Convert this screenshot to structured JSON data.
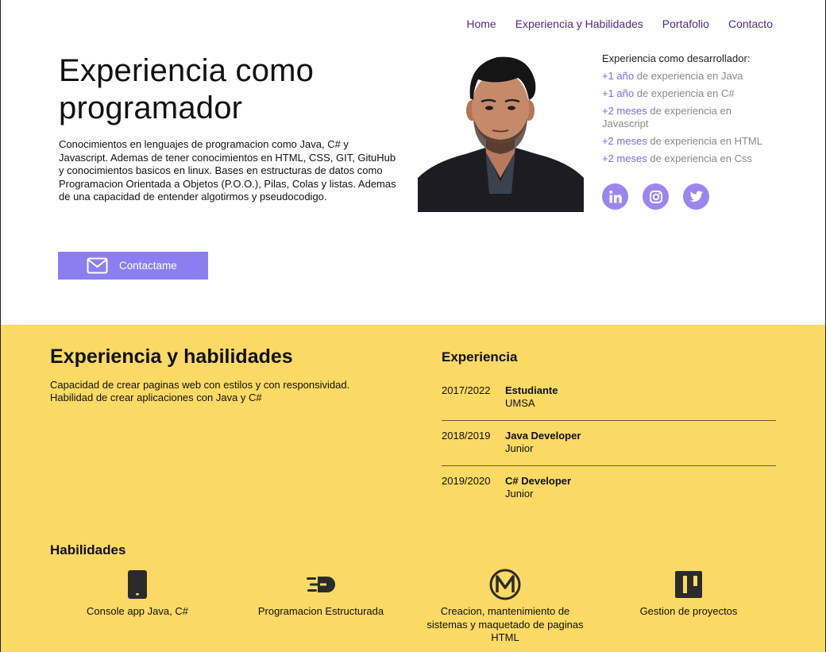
{
  "nav": {
    "items": [
      "Home",
      "Experiencia y Habilidades",
      "Portafolio",
      "Contacto"
    ]
  },
  "hero": {
    "title": "Experiencia como programador",
    "description": "Conocimientos en lenguajes de programacion como Java, C# y Javascript. Ademas de tener conocimientos en HTML, CSS, GIT, GituHub y conocimientos basicos en linux. Bases en estructuras de datos como Programacion Orientada a Objetos (P.O.O.), Pilas, Colas y listas. Ademas de una capacidad de entender algotirmos y pseudocodigo.",
    "cta_label": "Contactame"
  },
  "experience_side": {
    "title": "Experiencia como desarrollador:",
    "items": [
      {
        "highlight": "+1 año",
        "text": " de experiencia en Java"
      },
      {
        "highlight": "+1 año",
        "text": " de experiencia en C#"
      },
      {
        "highlight": "+2 meses",
        "text": " de experiencia en Javascript"
      },
      {
        "highlight": "+2 meses",
        "text": " de experiencia en HTML"
      },
      {
        "highlight": "+2 meses",
        "text": " de experiencia en Css"
      }
    ],
    "socials": [
      "linkedin-icon",
      "instagram-icon",
      "twitter-icon"
    ]
  },
  "skills_section": {
    "title": "Experiencia y habilidades",
    "description": "Capacidad de crear paginas web con estilos y con responsividad. Habilidad de crear aplicaciones con Java y C#",
    "experience_title": "Experiencia",
    "timeline": [
      {
        "years": "2017/2022",
        "role": "Estudiante",
        "org": "UMSA"
      },
      {
        "years": "2018/2019",
        "role": "Java Developer",
        "org": "Junior"
      },
      {
        "years": "2019/2020",
        "role": "C# Developer",
        "org": "Junior"
      }
    ],
    "skills_title": "Habilidades",
    "skills": [
      {
        "icon": "mobile-phone-icon",
        "label": "Console app Java, C#"
      },
      {
        "icon": "speed-icon",
        "label": "Programacion Estructurada"
      },
      {
        "icon": "m-logo-icon",
        "label": "Creacion, mantenimiento de sistemas y maquetado de paginas HTML"
      },
      {
        "icon": "trello-icon",
        "label": "Gestion de proyectos"
      }
    ]
  },
  "colors": {
    "accent": "#8c7ef0",
    "nav_text": "#4b2f7a",
    "yellow": "#fad964"
  }
}
